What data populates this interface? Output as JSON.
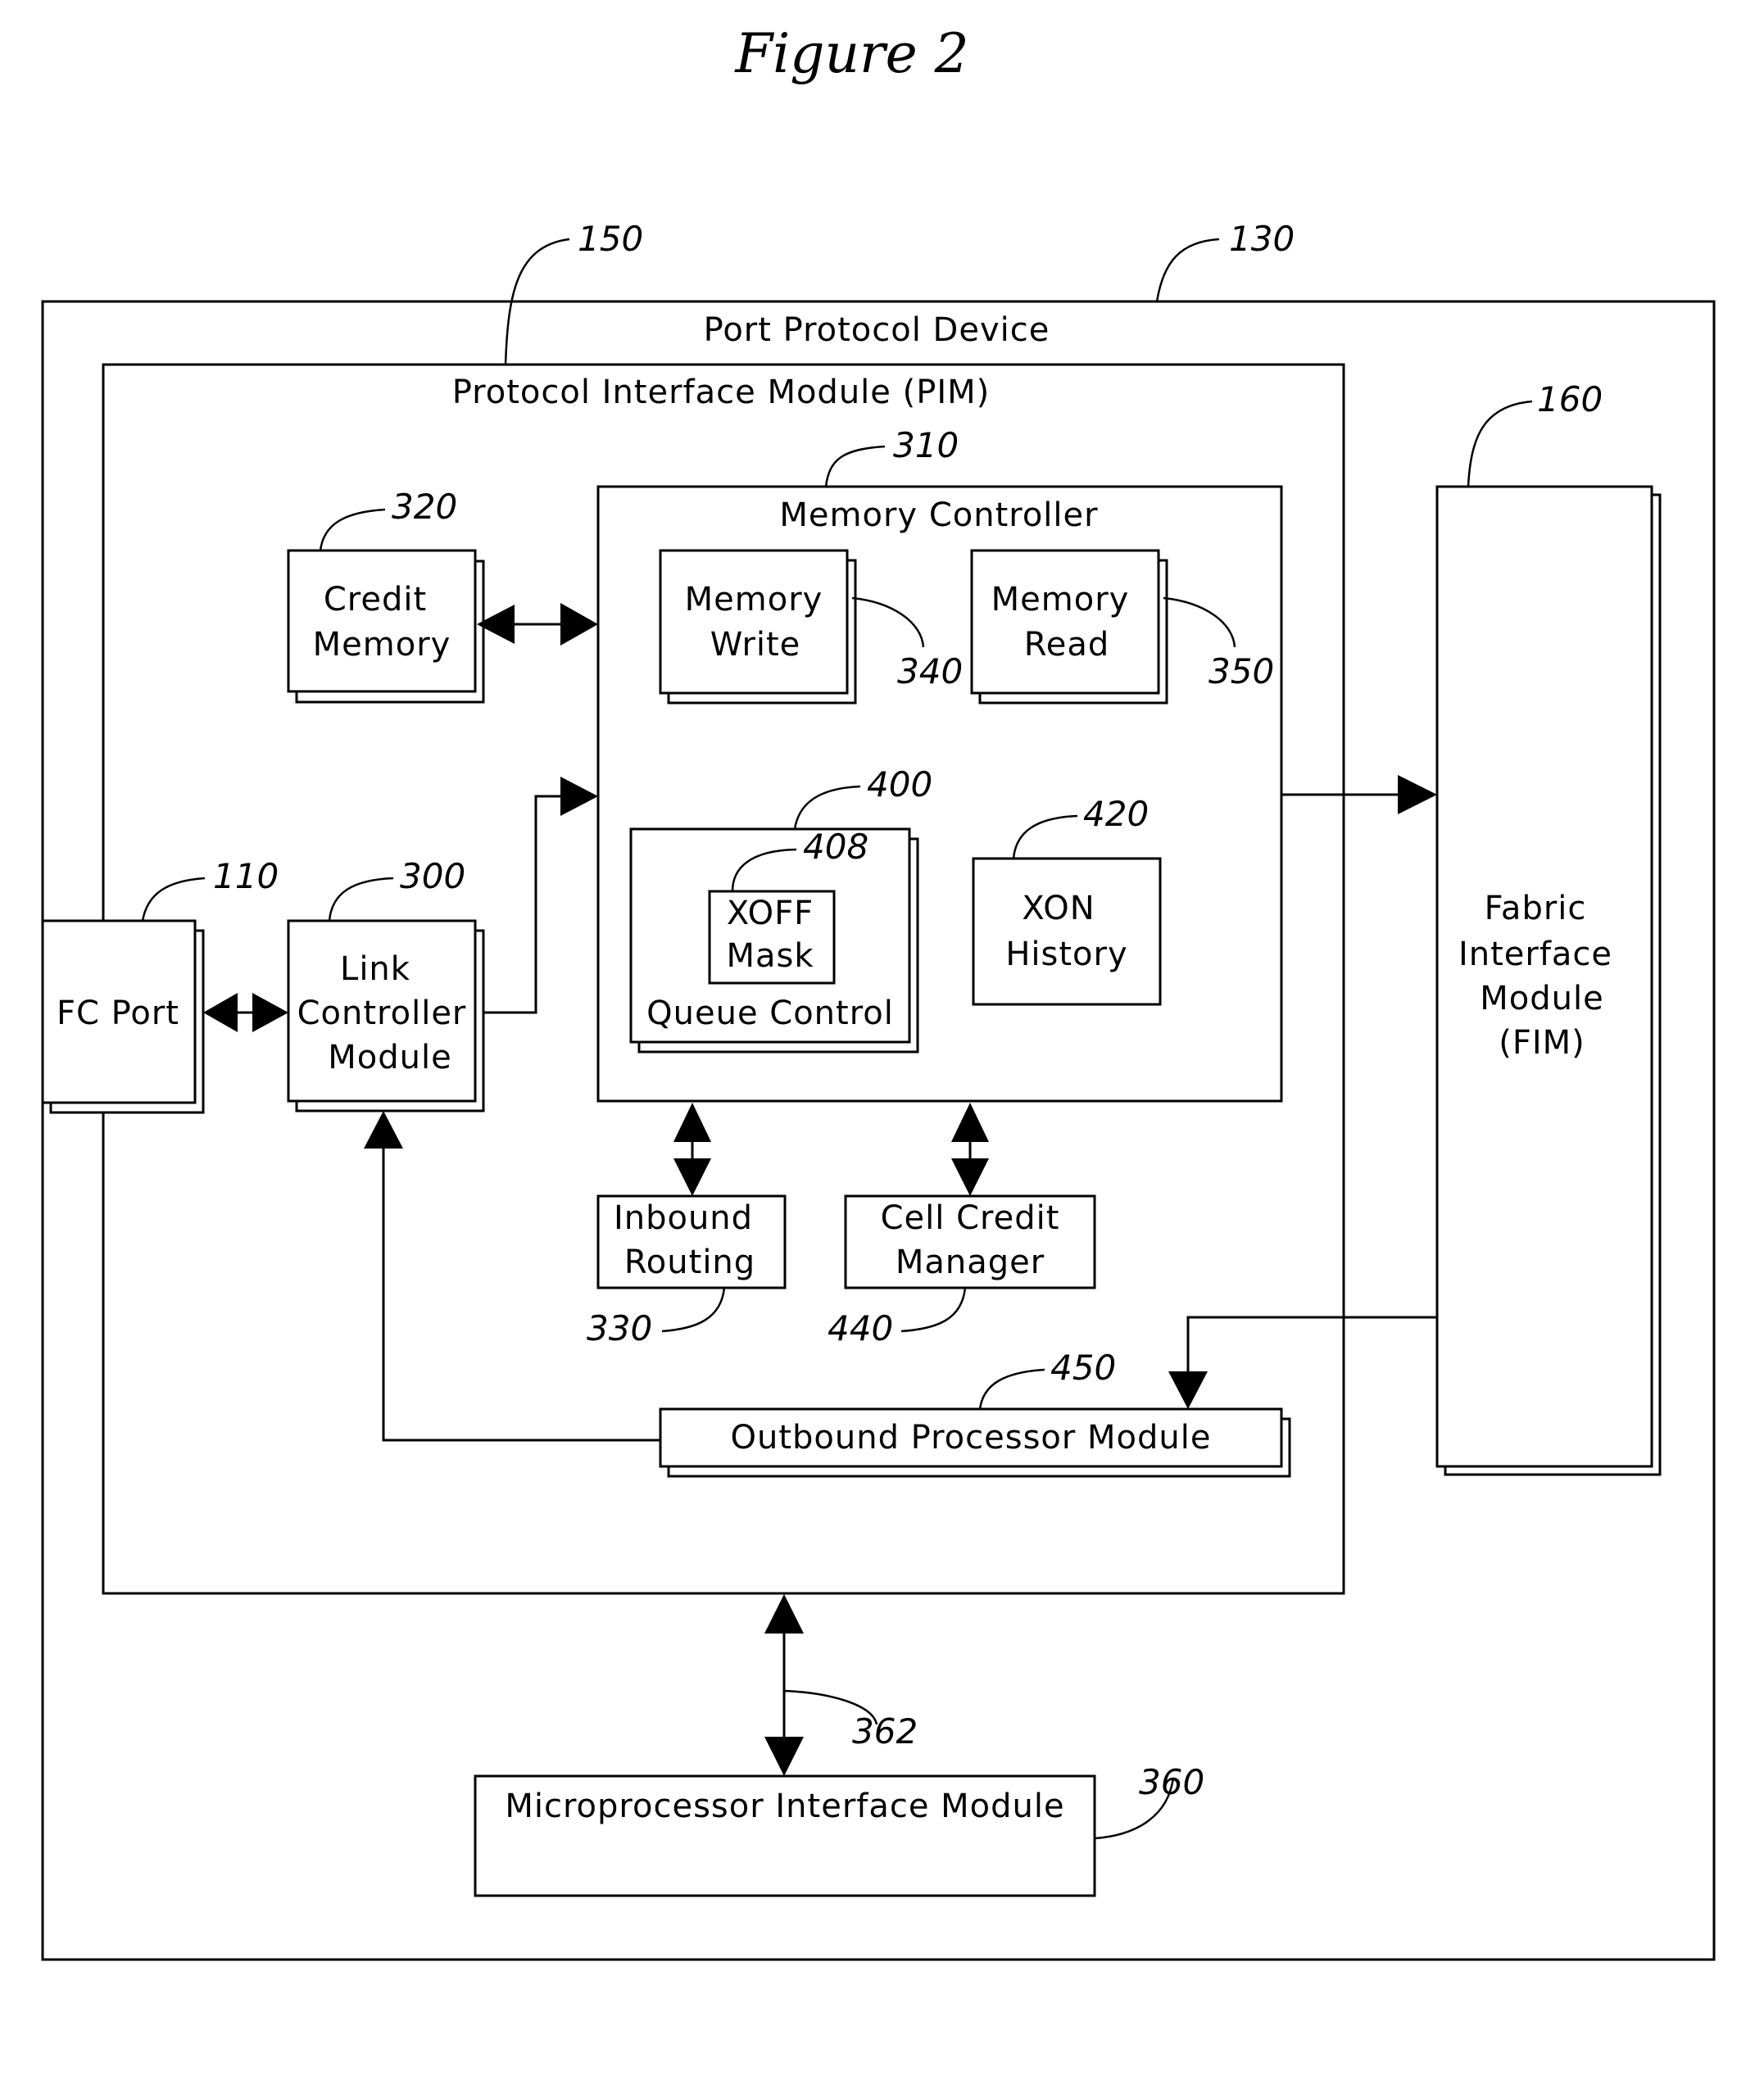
{
  "figure": {
    "title": "Figure 2"
  },
  "blocks": {
    "ppd": {
      "label": "Port Protocol Device",
      "ref": "130"
    },
    "pim": {
      "label": "Protocol Interface Module (PIM)",
      "ref": "150"
    },
    "memctl": {
      "label": "Memory Controller",
      "ref": "310"
    },
    "credit": {
      "lines": [
        "Credit",
        "Memory"
      ],
      "ref": "320"
    },
    "mwrite": {
      "lines": [
        "Memory",
        "Write"
      ],
      "ref": "340"
    },
    "mread": {
      "lines": [
        "Memory",
        "Read"
      ],
      "ref": "350"
    },
    "queue": {
      "label": "Queue Control",
      "ref": "400"
    },
    "xoff": {
      "lines": [
        "XOFF",
        "Mask"
      ],
      "ref": "408"
    },
    "xon": {
      "lines": [
        "XON",
        "History"
      ],
      "ref": "420"
    },
    "fcport": {
      "label": "FC Port",
      "ref": "110"
    },
    "lcm": {
      "lines": [
        "Link",
        "Controller",
        "Module"
      ],
      "ref": "300"
    },
    "fim": {
      "lines": [
        "Fabric",
        "Interface",
        "Module",
        "(FIM)"
      ],
      "ref": "160"
    },
    "inbound": {
      "lines": [
        "Inbound",
        "Routing"
      ],
      "ref": "330"
    },
    "ccm": {
      "lines": [
        "Cell Credit",
        "Manager"
      ],
      "ref": "440"
    },
    "opm": {
      "label": "Outbound Processor Module",
      "ref": "450"
    },
    "mim": {
      "label": "Microprocessor Interface Module",
      "ref": "360"
    },
    "bus": {
      "ref": "362"
    }
  }
}
